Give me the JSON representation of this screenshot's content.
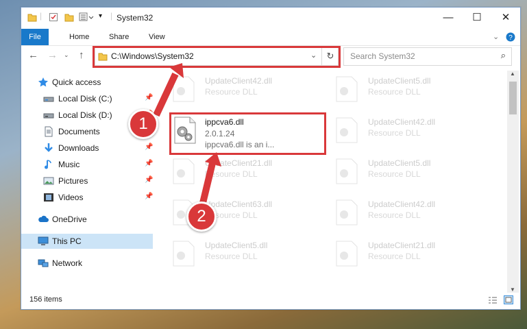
{
  "window": {
    "title": "System32"
  },
  "ribbon": {
    "tabs": [
      "File",
      "Home",
      "Share",
      "View"
    ]
  },
  "address": {
    "path": "C:\\Windows\\System32",
    "search_placeholder": "Search System32"
  },
  "nav": {
    "items": [
      {
        "label": "Quick access",
        "icon": "star-icon",
        "pinned": false
      },
      {
        "label": "Local Disk (C:)",
        "icon": "drive-icon",
        "pinned": true
      },
      {
        "label": "Local Disk (D:)",
        "icon": "drive-icon",
        "pinned": true
      },
      {
        "label": "Documents",
        "icon": "document-icon",
        "pinned": true
      },
      {
        "label": "Downloads",
        "icon": "download-icon",
        "pinned": true
      },
      {
        "label": "Music",
        "icon": "music-icon",
        "pinned": true
      },
      {
        "label": "Pictures",
        "icon": "pictures-icon",
        "pinned": true
      },
      {
        "label": "Videos",
        "icon": "videos-icon",
        "pinned": true
      },
      {
        "label": "OneDrive",
        "icon": "cloud-icon",
        "pinned": false
      },
      {
        "label": "This PC",
        "icon": "computer-icon",
        "pinned": false
      },
      {
        "label": "Network",
        "icon": "network-icon",
        "pinned": false
      }
    ]
  },
  "files": {
    "highlighted": {
      "name": "ippcva6.dll",
      "version": "2.0.1.24",
      "description": "ippcva6.dll is an i..."
    },
    "ghost_items": [
      {
        "name": "UpdateClient42.dll",
        "desc": "Resource DLL"
      },
      {
        "name": "UpdateClient5.dll",
        "desc": "Resource DLL"
      },
      {
        "name": "UpdateClient42.dll",
        "desc": "Resource DLL"
      },
      {
        "name": "UpdateClient21.dll",
        "desc": "Resource DLL"
      },
      {
        "name": "UpdateClient5.dll",
        "desc": "Resource DLL"
      },
      {
        "name": "UpdateClient63.dll",
        "desc": "Resource DLL"
      },
      {
        "name": "UpdateClient42.dll",
        "desc": "Resource DLL"
      },
      {
        "name": "UpdateClient5.dll",
        "desc": "Resource DLL"
      },
      {
        "name": "UpdateClient21.dll",
        "desc": "Resource DLL"
      }
    ]
  },
  "status": {
    "item_count": "156 items"
  },
  "callouts": [
    "1",
    "2"
  ],
  "colors": {
    "accent": "#1979ca",
    "highlight": "#d9383a",
    "selected": "#cce4f7"
  }
}
